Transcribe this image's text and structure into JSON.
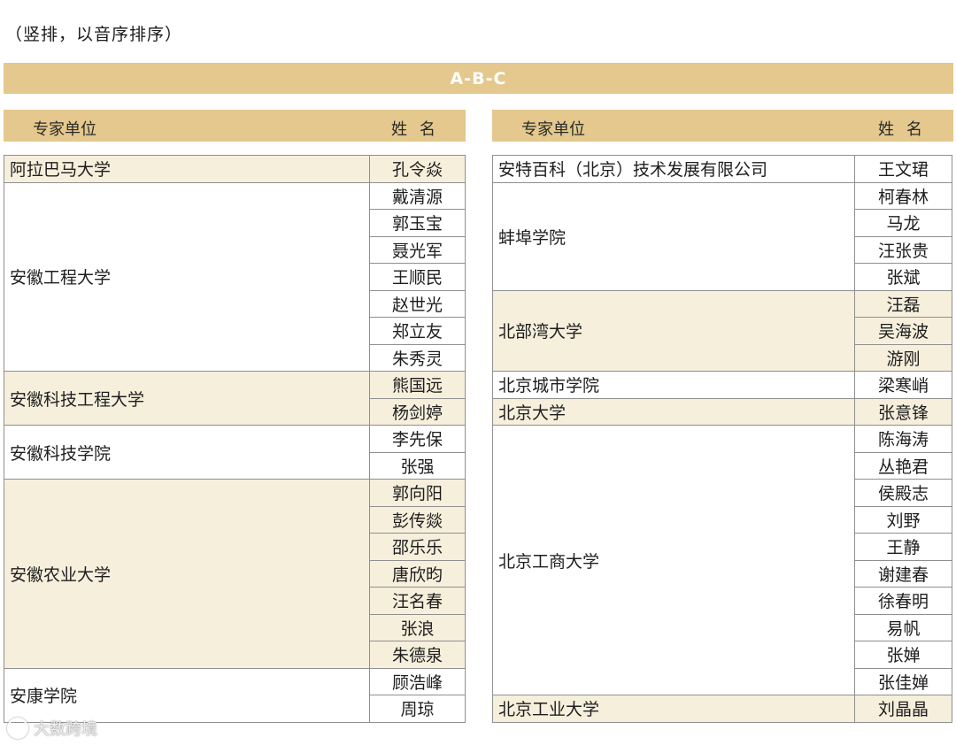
{
  "note": "（竖排，以音序排序）",
  "banner": "A-B-C",
  "headers": {
    "unit": "专家单位",
    "name": "姓名"
  },
  "left_groups": [
    {
      "unit": "阿拉巴马大学",
      "names": [
        "孔令焱"
      ],
      "shaded": true
    },
    {
      "unit": "安徽工程大学",
      "names": [
        "戴清源",
        "郭玉宝",
        "聂光军",
        "王顺民",
        "赵世光",
        "郑立友",
        "朱秀灵"
      ],
      "shaded": false
    },
    {
      "unit": "安徽科技工程大学",
      "names": [
        "熊国远",
        "杨剑婷"
      ],
      "shaded": true
    },
    {
      "unit": "安徽科技学院",
      "names": [
        "李先保",
        "张强"
      ],
      "shaded": false
    },
    {
      "unit": "安徽农业大学",
      "names": [
        "郭向阳",
        "彭传燚",
        "邵乐乐",
        "唐欣昀",
        "汪名春",
        "张浪",
        "朱德泉"
      ],
      "shaded": true
    },
    {
      "unit": "安康学院",
      "names": [
        "顾浩峰",
        "周琼"
      ],
      "shaded": false
    }
  ],
  "right_groups": [
    {
      "unit": "安特百科（北京）技术发展有限公司",
      "names": [
        "王文珺"
      ],
      "shaded": false
    },
    {
      "unit": "蚌埠学院",
      "names": [
        "柯春林",
        "马龙",
        "汪张贵",
        "张斌"
      ],
      "shaded": false
    },
    {
      "unit": "北部湾大学",
      "names": [
        "汪磊",
        "吴海波",
        "游刚"
      ],
      "shaded": true
    },
    {
      "unit": "北京城市学院",
      "names": [
        "梁寒峭"
      ],
      "shaded": false
    },
    {
      "unit": "北京大学",
      "names": [
        "张意锋"
      ],
      "shaded": true
    },
    {
      "unit": "北京工商大学",
      "names": [
        "陈海涛",
        "丛艳君",
        "侯殿志",
        "刘野",
        "王静",
        "谢建春",
        "徐春明",
        "易帆",
        "张婵",
        "张佳婵"
      ],
      "shaded": false
    },
    {
      "unit": "北京工业大学",
      "names": [
        "刘晶晶"
      ],
      "shaded": true
    }
  ],
  "watermark": "大数跨境"
}
